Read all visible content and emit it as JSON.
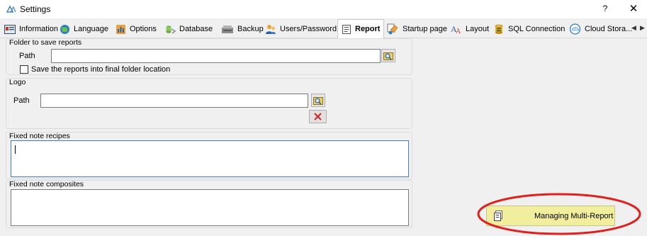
{
  "window": {
    "title": "Settings",
    "help_label": "?",
    "close_label": "✕"
  },
  "tabs": [
    {
      "label": "Information",
      "icon": "information-icon"
    },
    {
      "label": "Language",
      "icon": "globe-icon"
    },
    {
      "label": "Options",
      "icon": "options-icon"
    },
    {
      "label": "Database",
      "icon": "database-icon"
    },
    {
      "label": "Backup",
      "icon": "backup-icon"
    },
    {
      "label": "Users/Password",
      "icon": "users-icon"
    },
    {
      "label": "Report",
      "icon": "report-icon",
      "active": true
    },
    {
      "label": "Startup page",
      "icon": "startup-page-icon"
    },
    {
      "label": "Layout",
      "icon": "layout-icon"
    },
    {
      "label": "SQL Connection",
      "icon": "sql-connection-icon"
    },
    {
      "label": "Cloud Stora...",
      "icon": "cloud-storage-icon"
    }
  ],
  "tab_scroll": {
    "left": "◀",
    "right": "▶"
  },
  "report": {
    "folder_group": {
      "title": "Folder to save reports",
      "path_label": "Path",
      "path_value": "",
      "checkbox_label": "Save the reports into final folder location",
      "checkbox_checked": false
    },
    "logo_group": {
      "title": "Logo",
      "path_label": "Path",
      "path_value": ""
    },
    "fixed_note_recipes": {
      "title": "Fixed note recipes",
      "value": ""
    },
    "fixed_note_composites": {
      "title": "Fixed note composites",
      "value": ""
    },
    "managing_button_label": "Managing Multi-Report"
  },
  "colors": {
    "highlight_ellipse": "#e0201c",
    "managing_button_bg": "#f1ee9e",
    "delete_icon": "#d42020"
  }
}
